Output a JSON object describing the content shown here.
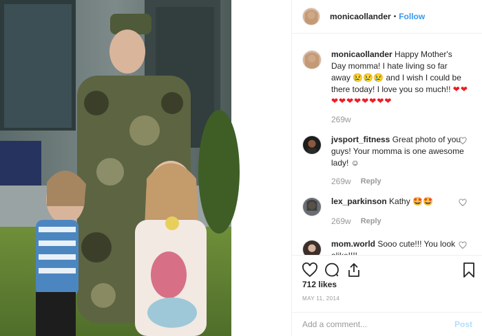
{
  "post": {
    "author": "monicaollander",
    "separator": "•",
    "follow_label": "Follow",
    "photo_description": "mother in camouflage uniform with two young daughters"
  },
  "comments": [
    {
      "user": "monicaollander",
      "text": "Happy Mother's Day momma! I hate living so far away 😢😢😢 and I wish I could be there today! I love you so much!! ",
      "hearts": "❤❤❤❤❤❤❤❤❤❤",
      "time": "269w",
      "reply": ""
    },
    {
      "user": "jvsport_fitness",
      "text": "Great photo of you guys! Your momma is one awesome lady! ☺",
      "time": "269w",
      "reply": "Reply"
    },
    {
      "user": "lex_parkinson",
      "text": "Kathy 🤩🤩",
      "time": "269w",
      "reply": "Reply"
    },
    {
      "user": "mom.world",
      "text": "Sooo cute!!! You look alike!!!!",
      "time": "",
      "reply": ""
    }
  ],
  "actions": {
    "like_icon": "heart-icon",
    "comment_icon": "comment-icon",
    "share_icon": "share-icon",
    "save_icon": "bookmark-icon"
  },
  "likes": "712 likes",
  "date": "MAY 11, 2014",
  "add_comment": {
    "placeholder": "Add a comment...",
    "post_label": "Post"
  },
  "colors": {
    "link": "#3897f0",
    "post_disabled": "#b2dffc",
    "heart": "#ed1c24",
    "meta": "#999999"
  }
}
